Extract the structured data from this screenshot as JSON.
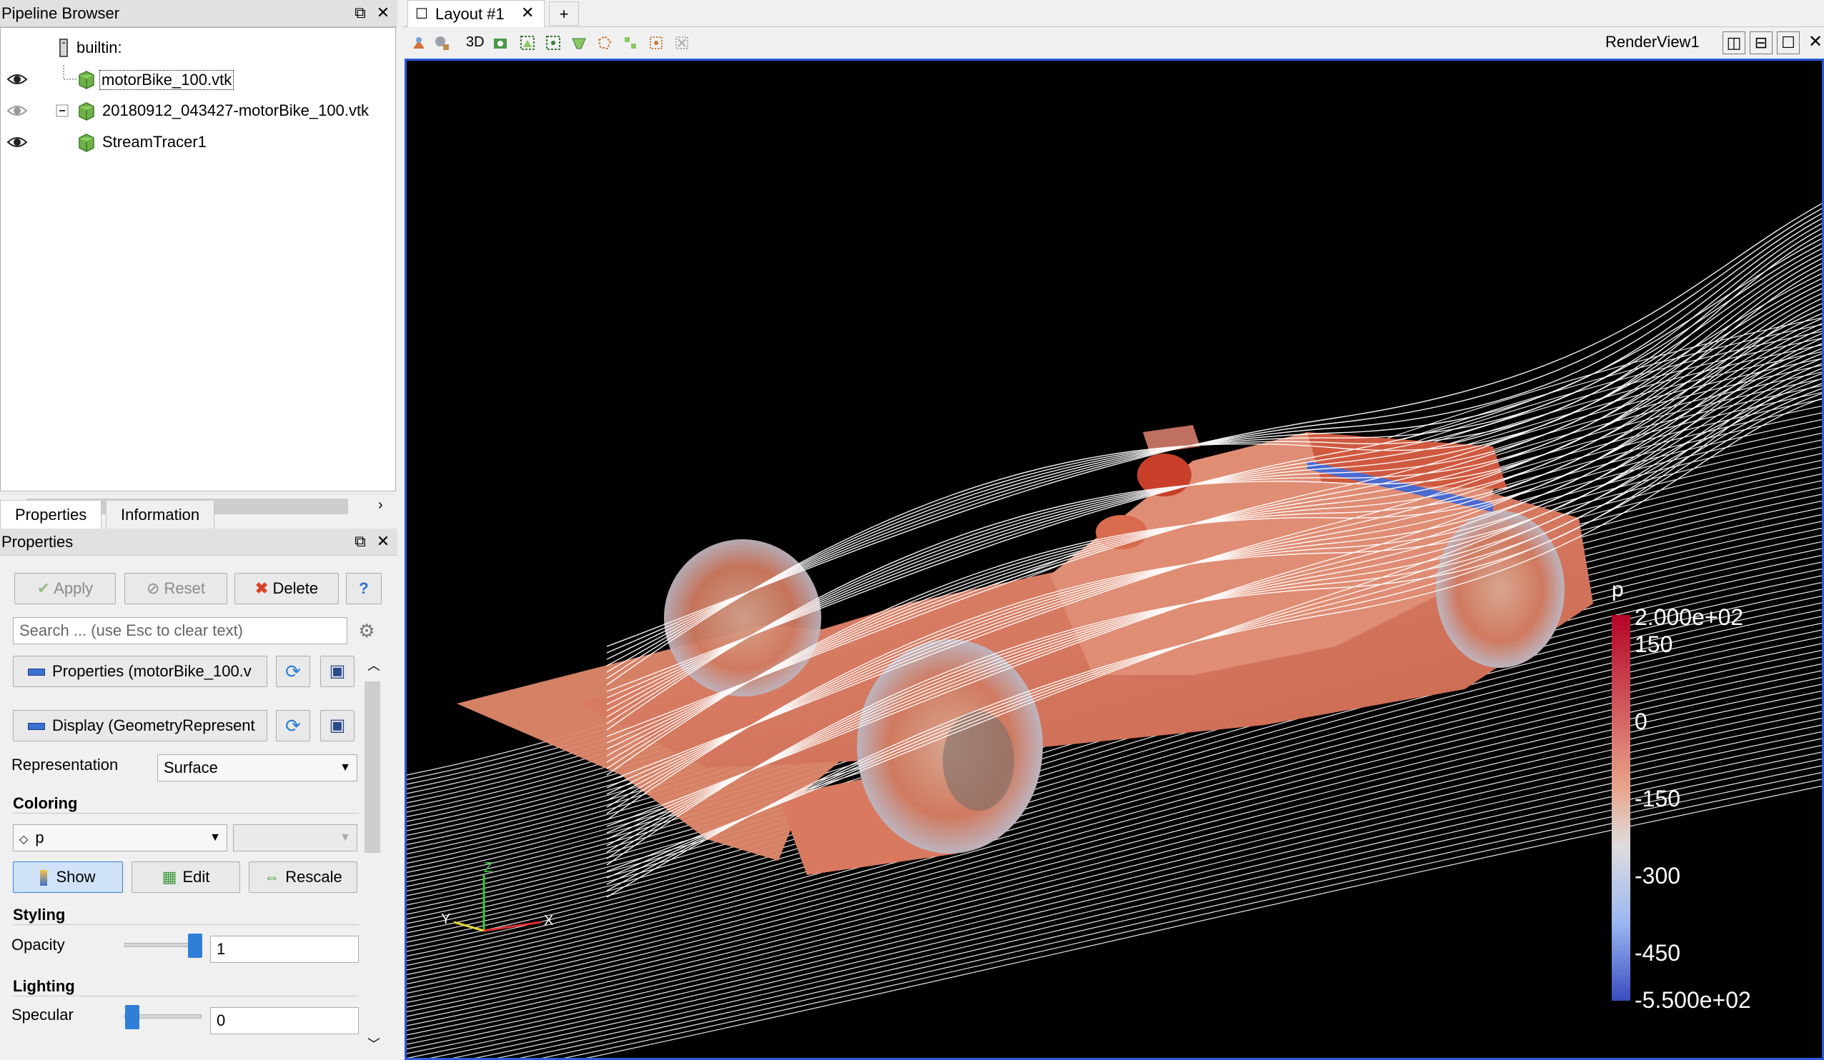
{
  "pipeline_browser": {
    "title": "Pipeline Browser",
    "items": [
      {
        "label": "builtin:"
      },
      {
        "label": "motorBike_100.vtk"
      },
      {
        "label": "20180912_043427-motorBike_100.vtk"
      },
      {
        "label": "StreamTracer1"
      }
    ]
  },
  "tabs": {
    "properties": "Properties",
    "information": "Information"
  },
  "properties_panel": {
    "title": "Properties",
    "apply": "Apply",
    "reset": "Reset",
    "delete": "Delete",
    "help": "?",
    "search_placeholder": "Search ... (use Esc to clear text)",
    "properties_section": "Properties (motorBike_100.v",
    "display_section": "Display (GeometryRepresent",
    "representation_label": "Representation",
    "representation_value": "Surface",
    "coloring_header": "Coloring",
    "coloring_value": "p",
    "show": "Show",
    "edit": "Edit",
    "rescale": "Rescale",
    "styling_header": "Styling",
    "opacity_label": "Opacity",
    "opacity_value": "1",
    "opacity_level": 1.0,
    "lighting_header": "Lighting",
    "specular_label": "Specular",
    "specular_value": "0",
    "specular_level": 0.0
  },
  "layout": {
    "tab_label": "Layout #1",
    "add_tab": "+",
    "toolbar_3d": "3D",
    "render_view_name": "RenderView1"
  },
  "scalar_bar": {
    "title": "p",
    "max_label": "2.000e+02",
    "min_label": "-5.500e+02",
    "ticks": [
      "150",
      "0",
      "-150",
      "-300",
      "-450"
    ]
  },
  "axes": {
    "z": "Z",
    "x": "X",
    "y": "Y"
  },
  "colors": {
    "accent": "#2c5bd8",
    "view_bg": "#000000",
    "colormap_high": "#b40426",
    "colormap_mid": "#dddddd",
    "colormap_low": "#3b4cc0"
  }
}
